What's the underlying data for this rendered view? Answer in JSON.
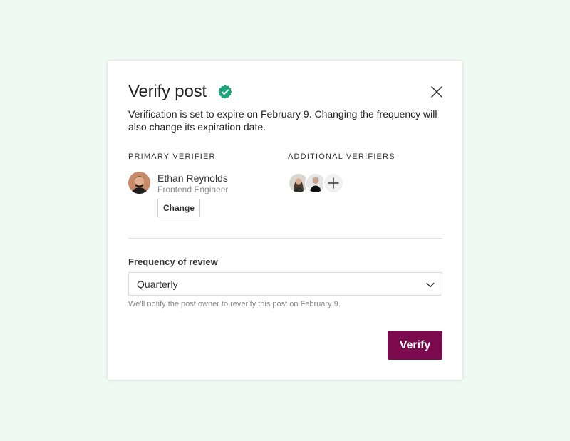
{
  "modal": {
    "title": "Verify post",
    "description": "Verification is set to expire on February 9. Changing the frequency will also change its expiration date.",
    "verified_icon": "verified-badge-icon",
    "close_icon": "close-icon"
  },
  "primary_verifier": {
    "section_label": "PRIMARY VERIFIER",
    "name": "Ethan Reynolds",
    "role": "Frontend Engineer",
    "change_label": "Change"
  },
  "additional_verifiers": {
    "section_label": "ADDITIONAL VERIFIERS",
    "add_icon": "plus-icon"
  },
  "frequency": {
    "label": "Frequency of review",
    "selected": "Quarterly",
    "helper": "We'll notify the post owner to reverify this post on February 9."
  },
  "actions": {
    "verify_label": "Verify"
  },
  "colors": {
    "background": "#edf9f2",
    "verified_badge": "#1aa57a",
    "primary_button": "#7a0a4d"
  }
}
